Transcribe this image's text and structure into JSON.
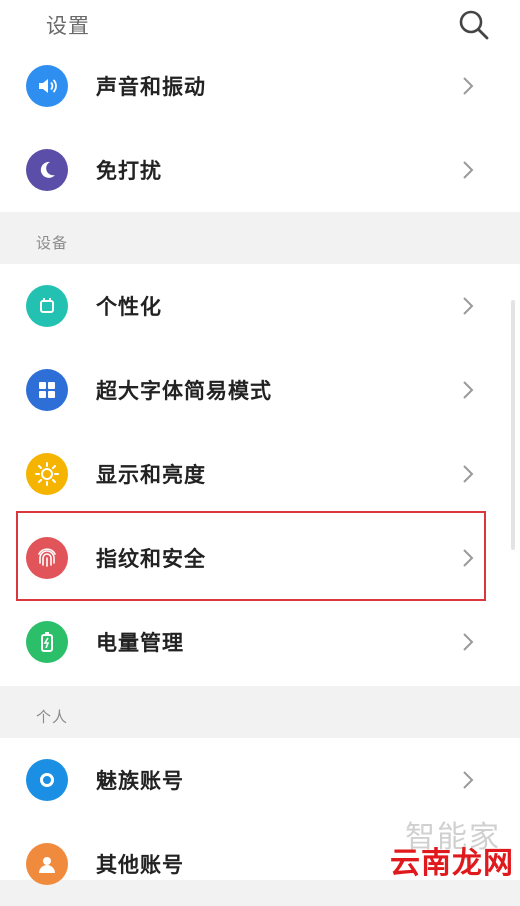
{
  "header": {
    "title": "设置",
    "search_icon": "search-icon"
  },
  "sections": [
    {
      "label": "设备"
    },
    {
      "label": "个人"
    }
  ],
  "rows": [
    {
      "label": "声音和振动",
      "icon": "speaker-icon",
      "color": "#2f8ff0"
    },
    {
      "label": "免打扰",
      "icon": "moon-icon",
      "color": "#5a4ea8"
    },
    {
      "label": "个性化",
      "icon": "theme-icon",
      "color": "#22c1b2"
    },
    {
      "label": "超大字体简易模式",
      "icon": "grid-icon",
      "color": "#2d6fd6"
    },
    {
      "label": "显示和亮度",
      "icon": "sun-icon",
      "color": "#f5b400"
    },
    {
      "label": "指纹和安全",
      "icon": "fingerprint-icon",
      "color": "#e0545a",
      "highlighted": true
    },
    {
      "label": "电量管理",
      "icon": "battery-icon",
      "color": "#2bbf6a"
    },
    {
      "label": "魅族账号",
      "icon": "meizu-account-icon",
      "color": "#1a8fe3"
    },
    {
      "label": "其他账号",
      "icon": "person-icon",
      "color": "#f08a3c"
    }
  ],
  "watermark": {
    "top": "智能家",
    "bottom": "云南龙网"
  }
}
